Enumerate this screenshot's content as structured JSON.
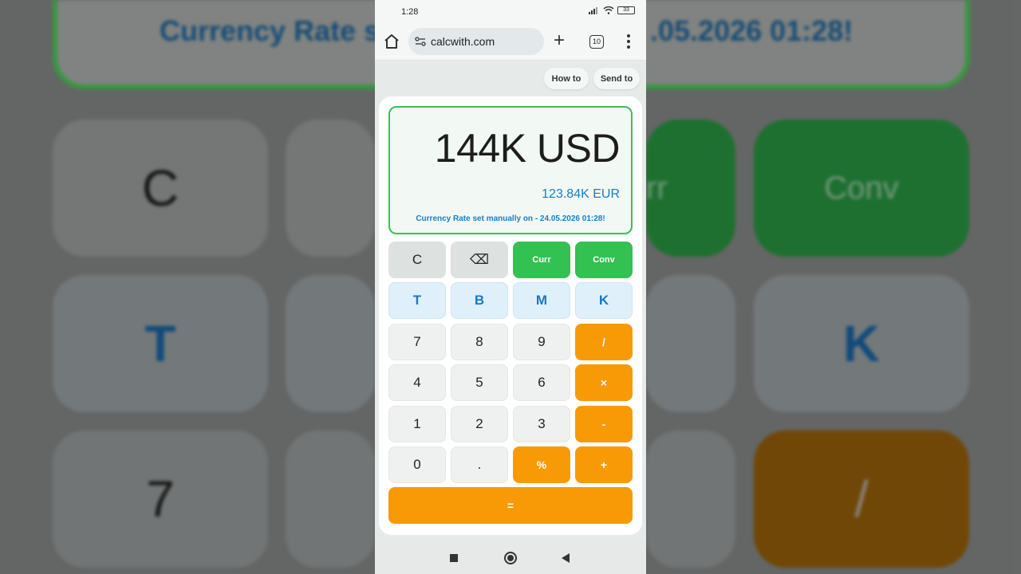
{
  "background": {
    "rate_text_left": "Currency Rate s",
    "rate_text_right": ".05.2026 01:28!",
    "keys": {
      "c": "C",
      "backspace": "⌫",
      "curr": "rr",
      "conv": "Conv",
      "t": "T",
      "k": "K",
      "seven": "7",
      "divide": "/"
    }
  },
  "status_bar": {
    "time": "1:28",
    "battery": "33"
  },
  "browser": {
    "url": "calcwith.com",
    "new_tab": "+",
    "tab_count": "10"
  },
  "toolbar": {
    "how_to": "How to",
    "send_to": "Send to"
  },
  "display": {
    "main_value": "144K USD",
    "converted_value": "123.84K EUR",
    "rate_note": "Currency Rate set manually on - 24.05.2026 01:28!"
  },
  "keypad": {
    "clear": "C",
    "backspace": "⌫",
    "curr": "Curr",
    "conv": "Conv",
    "t": "T",
    "b": "B",
    "m": "M",
    "k": "K",
    "seven": "7",
    "eight": "8",
    "nine": "9",
    "divide": "/",
    "four": "4",
    "five": "5",
    "six": "6",
    "multiply": "×",
    "one": "1",
    "two": "2",
    "three": "3",
    "minus": "-",
    "zero": "0",
    "dot": ".",
    "percent": "%",
    "plus": "+",
    "equals": "="
  },
  "colors": {
    "green": "#33c152",
    "orange": "#f79a06",
    "blue": "#1b7dc6"
  }
}
